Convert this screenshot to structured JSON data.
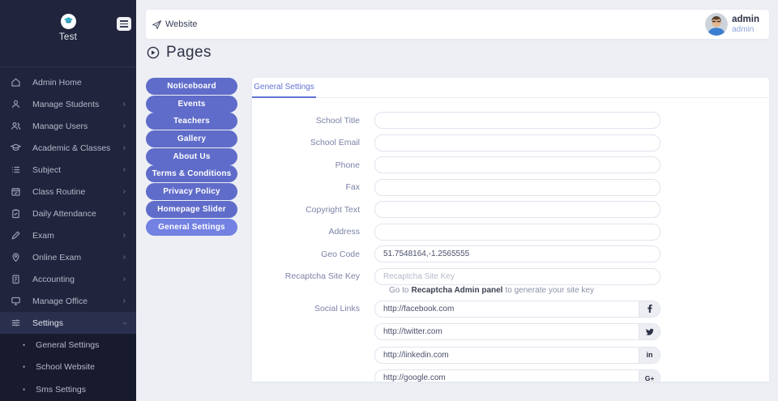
{
  "colors": {
    "sidebar_bg": "#20243c",
    "accent_blue": "#6273d4",
    "pill": "#5f6cc9",
    "pill_active": "#7381e2",
    "logo_teal": "#35aec6",
    "user_role_blue": "#8fa3de"
  },
  "sidebar": {
    "logo_text": "Test",
    "menu_icon": "menu-icon",
    "items": [
      {
        "label": "Admin Home",
        "icon": "home-icon",
        "arrow": ""
      },
      {
        "label": "Manage Students",
        "icon": "student-icon",
        "arrow": "›"
      },
      {
        "label": "Manage Users",
        "icon": "users-icon",
        "arrow": "›"
      },
      {
        "label": "Academic & Classes",
        "icon": "graduation-cap-icon",
        "arrow": "›"
      },
      {
        "label": "Subject",
        "icon": "list-icon",
        "arrow": "›"
      },
      {
        "label": "Class Routine",
        "icon": "calendar-icon",
        "arrow": "›"
      },
      {
        "label": "Daily Attendance",
        "icon": "clipboard-check-icon",
        "arrow": "›"
      },
      {
        "label": "Exam",
        "icon": "pencil-icon",
        "arrow": "›"
      },
      {
        "label": "Online Exam",
        "icon": "map-pin-icon",
        "arrow": "›"
      },
      {
        "label": "Accounting",
        "icon": "ledger-icon",
        "arrow": "›"
      },
      {
        "label": "Manage Office",
        "icon": "monitor-icon",
        "arrow": "›"
      },
      {
        "label": "Settings",
        "icon": "sliders-icon",
        "arrow": "›"
      }
    ],
    "submenu": [
      {
        "label": "General Settings"
      },
      {
        "label": "School Website"
      },
      {
        "label": "Sms Settings"
      }
    ]
  },
  "topbar": {
    "website_label": "Website",
    "website_icon": "paper-plane-icon",
    "user_name": "admin",
    "user_role": "admin",
    "avatar": "user-avatar"
  },
  "page": {
    "title": "Pages",
    "title_icon": "arrow-circle-right-icon"
  },
  "pills": [
    {
      "label": "Noticeboard"
    },
    {
      "label": "Events"
    },
    {
      "label": "Teachers"
    },
    {
      "label": "Gallery"
    },
    {
      "label": "About Us"
    },
    {
      "label": "Terms & Conditions"
    },
    {
      "label": "Privacy Policy"
    },
    {
      "label": "Homepage Slider"
    },
    {
      "label": "General Settings"
    }
  ],
  "tab": {
    "label": "General Settings"
  },
  "form": {
    "fields": [
      {
        "label": "School Title",
        "value": "",
        "placeholder": ""
      },
      {
        "label": "School Email",
        "value": "",
        "placeholder": ""
      },
      {
        "label": "Phone",
        "value": "",
        "placeholder": ""
      },
      {
        "label": "Fax",
        "value": "",
        "placeholder": ""
      },
      {
        "label": "Copyright Text",
        "value": "",
        "placeholder": ""
      },
      {
        "label": "Address",
        "value": "",
        "placeholder": ""
      },
      {
        "label": "Geo Code",
        "value": "51.7548164,-1.2565555",
        "placeholder": ""
      },
      {
        "label": "Recaptcha Site Key",
        "value": "",
        "placeholder": "Recaptcha Site Key"
      }
    ],
    "recaptcha_hint_prefix": "Go to",
    "recaptcha_hint_bold": "Recaptcha Admin panel",
    "recaptcha_hint_suffix": "to generate your site key",
    "social_label": "Social Links",
    "social": [
      {
        "value": "http://facebook.com",
        "icon": "facebook-icon",
        "glyph": "f"
      },
      {
        "value": "http://twitter.com",
        "icon": "twitter-icon",
        "glyph": ""
      },
      {
        "value": "http://linkedin.com",
        "icon": "linkedin-icon",
        "glyph": "in"
      },
      {
        "value": "http://google.com",
        "icon": "google-plus-icon",
        "glyph": "G+"
      }
    ]
  }
}
